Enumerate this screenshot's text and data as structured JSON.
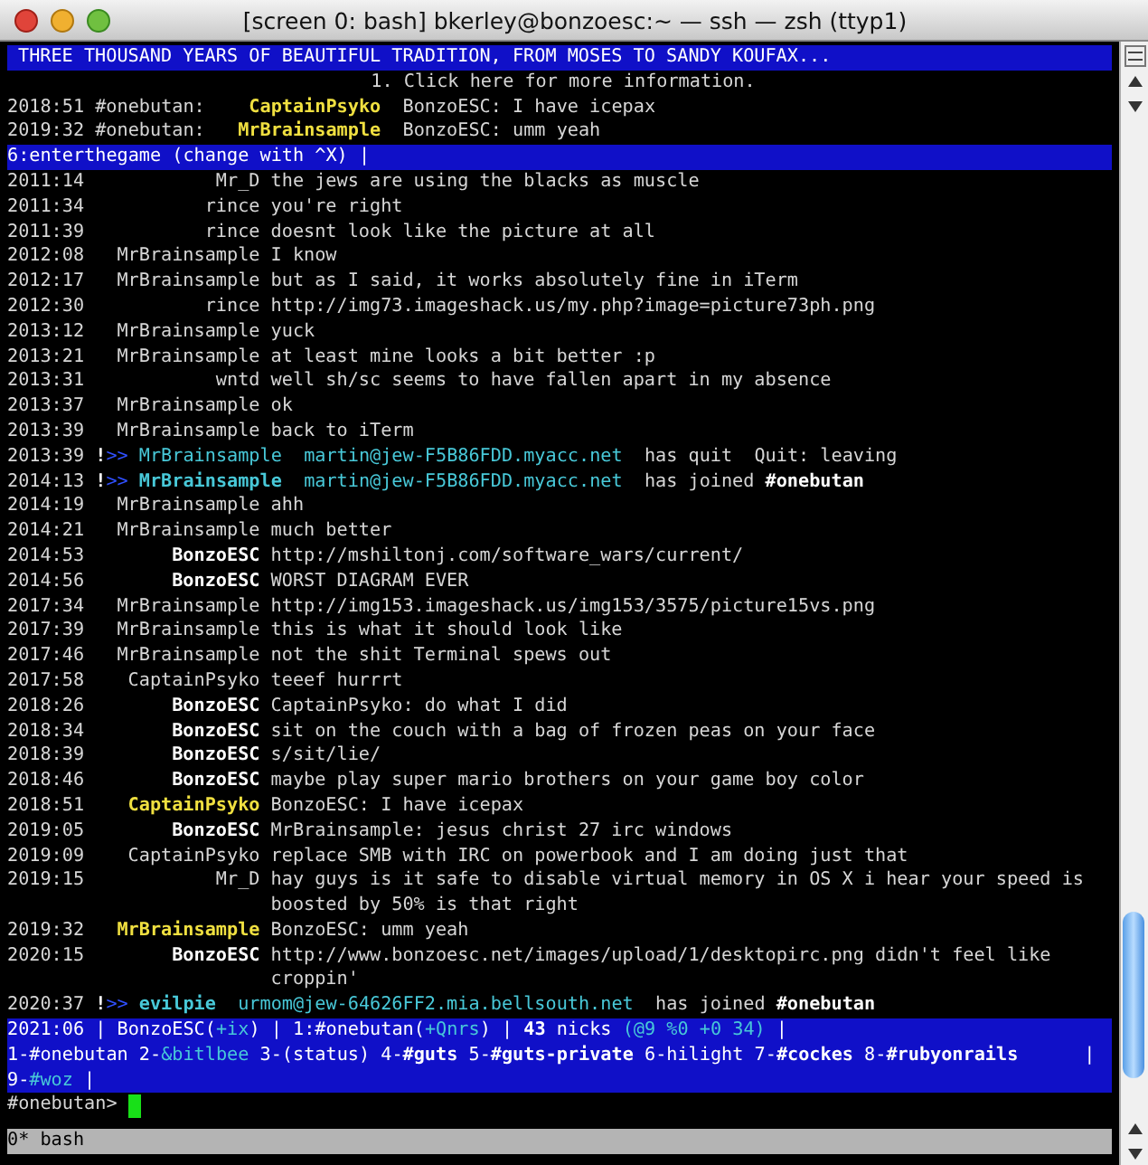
{
  "window": {
    "title": "[screen 0: bash] bkerley@bonzoesc:~ — ssh — zsh (ttyp1)"
  },
  "topic": "THREE THOUSAND YEARS OF BEAUTIFUL TRADITION, FROM MOSES TO SANDY KOUFAX...",
  "info_line": "1. Click here for more information.",
  "highlights": [
    {
      "time": "2018:51",
      "channel": "#onebutan:",
      "nick": "CaptainPsyko",
      "text": "BonzoESC: I have icepax"
    },
    {
      "time": "2019:32",
      "channel": "#onebutan:",
      "nick": "MrBrainsample",
      "text": "BonzoESC: umm yeah"
    }
  ],
  "query_bar": "6:enterthegame (change with ^X) |",
  "messages": [
    {
      "kind": "msg",
      "time": "2011:14",
      "nick": "Mr_D",
      "is_self": false,
      "highlighted": false,
      "text": "the jews are using the blacks as muscle"
    },
    {
      "kind": "msg",
      "time": "2011:34",
      "nick": "rince",
      "is_self": false,
      "highlighted": false,
      "text": "you're right"
    },
    {
      "kind": "msg",
      "time": "2011:39",
      "nick": "rince",
      "is_self": false,
      "highlighted": false,
      "text": "doesnt look like the picture at all"
    },
    {
      "kind": "msg",
      "time": "2012:08",
      "nick": "MrBrainsample",
      "is_self": false,
      "highlighted": false,
      "text": "I know"
    },
    {
      "kind": "msg",
      "time": "2012:17",
      "nick": "MrBrainsample",
      "is_self": false,
      "highlighted": false,
      "text": "but as I said, it works absolutely fine in iTerm"
    },
    {
      "kind": "msg",
      "time": "2012:30",
      "nick": "rince",
      "is_self": false,
      "highlighted": false,
      "text": "http://img73.imageshack.us/my.php?image=picture73ph.png"
    },
    {
      "kind": "msg",
      "time": "2013:12",
      "nick": "MrBrainsample",
      "is_self": false,
      "highlighted": false,
      "text": "yuck"
    },
    {
      "kind": "msg",
      "time": "2013:21",
      "nick": "MrBrainsample",
      "is_self": false,
      "highlighted": false,
      "text": "at least mine looks a bit better :p"
    },
    {
      "kind": "msg",
      "time": "2013:31",
      "nick": "wntd",
      "is_self": false,
      "highlighted": false,
      "text": "well sh/sc seems to have fallen apart in my absence"
    },
    {
      "kind": "msg",
      "time": "2013:37",
      "nick": "MrBrainsample",
      "is_self": false,
      "highlighted": false,
      "text": "ok"
    },
    {
      "kind": "msg",
      "time": "2013:39",
      "nick": "MrBrainsample",
      "is_self": false,
      "highlighted": false,
      "text": "back to iTerm"
    },
    {
      "kind": "quit",
      "time": "2013:39",
      "bang": "!",
      "arrows": ">>",
      "nick": "MrBrainsample",
      "host": "martin@jew-F5B86FDD.myacc.net",
      "text": "has quit  Quit: leaving"
    },
    {
      "kind": "join",
      "time": "2014:13",
      "bang": "!",
      "arrows": ">>",
      "nick": "MrBrainsample",
      "host": "martin@jew-F5B86FDD.myacc.net",
      "text": "has joined",
      "channel": "#onebutan"
    },
    {
      "kind": "msg",
      "time": "2014:19",
      "nick": "MrBrainsample",
      "is_self": false,
      "highlighted": false,
      "text": "ahh"
    },
    {
      "kind": "msg",
      "time": "2014:21",
      "nick": "MrBrainsample",
      "is_self": false,
      "highlighted": false,
      "text": "much better"
    },
    {
      "kind": "msg",
      "time": "2014:53",
      "nick": "BonzoESC",
      "is_self": true,
      "highlighted": false,
      "text": "http://mshiltonj.com/software_wars/current/"
    },
    {
      "kind": "msg",
      "time": "2014:56",
      "nick": "BonzoESC",
      "is_self": true,
      "highlighted": false,
      "text": "WORST DIAGRAM EVER"
    },
    {
      "kind": "msg",
      "time": "2017:34",
      "nick": "MrBrainsample",
      "is_self": false,
      "highlighted": false,
      "text": "http://img153.imageshack.us/img153/3575/picture15vs.png"
    },
    {
      "kind": "msg",
      "time": "2017:39",
      "nick": "MrBrainsample",
      "is_self": false,
      "highlighted": false,
      "text": "this is what it should look like"
    },
    {
      "kind": "msg",
      "time": "2017:46",
      "nick": "MrBrainsample",
      "is_self": false,
      "highlighted": false,
      "text": "not the shit Terminal spews out"
    },
    {
      "kind": "msg",
      "time": "2017:58",
      "nick": "CaptainPsyko",
      "is_self": false,
      "highlighted": false,
      "text": "teeef hurrrt"
    },
    {
      "kind": "msg",
      "time": "2018:26",
      "nick": "BonzoESC",
      "is_self": true,
      "highlighted": false,
      "text": "CaptainPsyko: do what I did"
    },
    {
      "kind": "msg",
      "time": "2018:34",
      "nick": "BonzoESC",
      "is_self": true,
      "highlighted": false,
      "text": "sit on the couch with a bag of frozen peas on your face"
    },
    {
      "kind": "msg",
      "time": "2018:39",
      "nick": "BonzoESC",
      "is_self": true,
      "highlighted": false,
      "text": "s/sit/lie/"
    },
    {
      "kind": "msg",
      "time": "2018:46",
      "nick": "BonzoESC",
      "is_self": true,
      "highlighted": false,
      "text": "maybe play super mario brothers on your game boy color"
    },
    {
      "kind": "msg",
      "time": "2018:51",
      "nick": "CaptainPsyko",
      "is_self": false,
      "highlighted": true,
      "text": "BonzoESC: I have icepax"
    },
    {
      "kind": "msg",
      "time": "2019:05",
      "nick": "BonzoESC",
      "is_self": true,
      "highlighted": false,
      "text": "MrBrainsample: jesus christ 27 irc windows"
    },
    {
      "kind": "msg",
      "time": "2019:09",
      "nick": "CaptainPsyko",
      "is_self": false,
      "highlighted": false,
      "text": "replace SMB with IRC on powerbook and I am doing just that"
    },
    {
      "kind": "msg",
      "time": "2019:15",
      "nick": "Mr_D",
      "is_self": false,
      "highlighted": false,
      "text": "hay guys is it safe to disable virtual memory in OS X i hear your speed is boosted by 50% is that right"
    },
    {
      "kind": "msg",
      "time": "2019:32",
      "nick": "MrBrainsample",
      "is_self": false,
      "highlighted": true,
      "text": "BonzoESC: umm yeah"
    },
    {
      "kind": "msg",
      "time": "2020:15",
      "nick": "BonzoESC",
      "is_self": true,
      "highlighted": false,
      "text": "http://www.bonzoesc.net/images/upload/1/desktopirc.png didn't feel like croppin'"
    },
    {
      "kind": "join",
      "time": "2020:37",
      "bang": "!",
      "arrows": ">>",
      "nick": "evilpie",
      "host": "urmom@jew-64626FF2.mia.bellsouth.net",
      "text": "has joined",
      "channel": "#onebutan"
    }
  ],
  "status_lines": [
    [
      {
        "text": "2021:06 | BonzoESC(",
        "kind": "text"
      },
      {
        "text": "+ix",
        "kind": "mode"
      },
      {
        "text": ") | 1:#onebutan(",
        "kind": "text"
      },
      {
        "text": "+Qnrs",
        "kind": "mode"
      },
      {
        "text": ") | ",
        "kind": "text"
      },
      {
        "text": "43",
        "kind": "count"
      },
      {
        "text": " nicks ",
        "kind": "text"
      },
      {
        "text": "(@9 %0 +0 34)",
        "kind": "mode"
      },
      {
        "text": " |",
        "kind": "text"
      }
    ],
    [
      {
        "text": "1-#onebutan 2-",
        "kind": "text"
      },
      {
        "text": "&bitlbee",
        "kind": "activity"
      },
      {
        "text": " 3-(status) 4-",
        "kind": "text"
      },
      {
        "text": "#guts",
        "kind": "message"
      },
      {
        "text": " 5-",
        "kind": "text"
      },
      {
        "text": "#guts-private",
        "kind": "message"
      },
      {
        "text": " 6-hilight 7-",
        "kind": "text"
      },
      {
        "text": "#cockes",
        "kind": "message"
      },
      {
        "text": " 8-",
        "kind": "text"
      },
      {
        "text": "#rubyonrails",
        "kind": "message"
      },
      {
        "text": "      |",
        "kind": "text"
      }
    ],
    [
      {
        "text": "9-",
        "kind": "text"
      },
      {
        "text": "#woz",
        "kind": "activity"
      },
      {
        "text": " |",
        "kind": "text"
      }
    ]
  ],
  "prompt": "#onebutan>",
  "screen_bar": "0* bash"
}
